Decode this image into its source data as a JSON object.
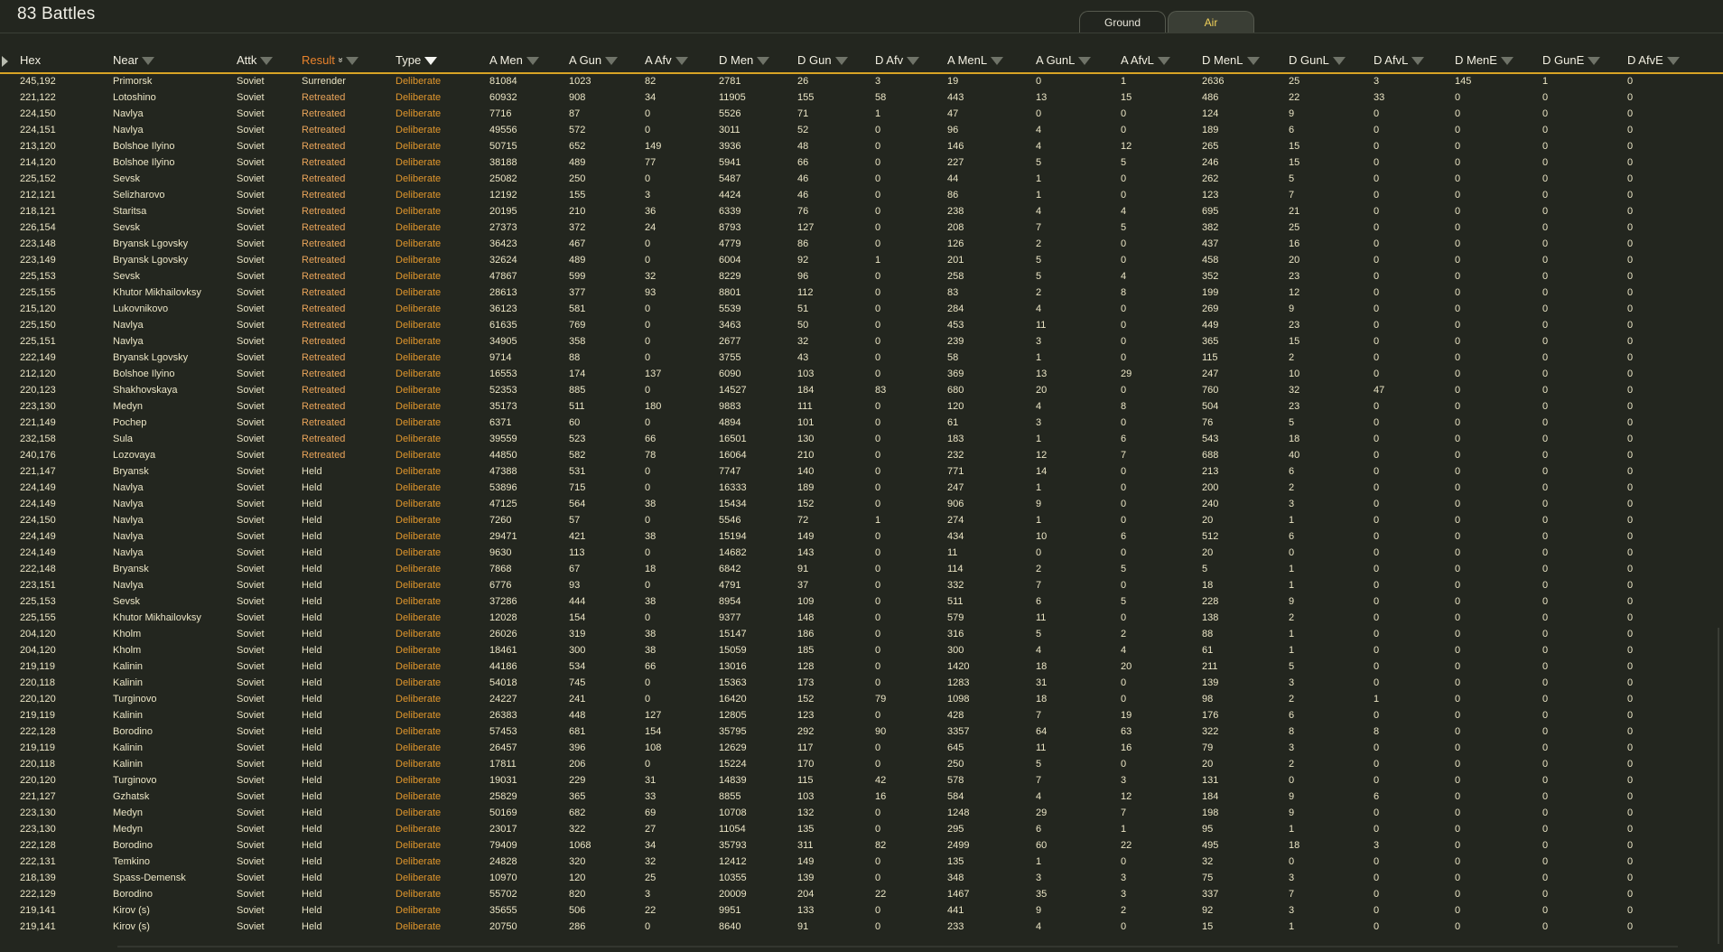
{
  "title": "83 Battles",
  "tabs": [
    {
      "label": "Ground",
      "active": false
    },
    {
      "label": "Air",
      "active": true
    }
  ],
  "colors": {
    "accent": "#d8a325",
    "type_text": "#e0962c",
    "sorted_header": "#e8822c",
    "background": "#23261f"
  },
  "columns": [
    {
      "key": "hex",
      "label": "Hex",
      "filter": false
    },
    {
      "key": "near",
      "label": "Near",
      "filter": true
    },
    {
      "key": "attk",
      "label": "Attk",
      "filter": true
    },
    {
      "key": "result",
      "label": "Result",
      "filter": true,
      "sorted": true
    },
    {
      "key": "type",
      "label": "Type",
      "filter": true,
      "filter_active": true
    },
    {
      "key": "a_men",
      "label": "A Men",
      "filter": true
    },
    {
      "key": "a_gun",
      "label": "A Gun",
      "filter": true
    },
    {
      "key": "a_afv",
      "label": "A Afv",
      "filter": true
    },
    {
      "key": "d_men",
      "label": "D Men",
      "filter": true
    },
    {
      "key": "d_gun",
      "label": "D Gun",
      "filter": true
    },
    {
      "key": "d_afv",
      "label": "D Afv",
      "filter": true
    },
    {
      "key": "a_menl",
      "label": "A MenL",
      "filter": true
    },
    {
      "key": "a_gunl",
      "label": "A GunL",
      "filter": true
    },
    {
      "key": "a_afvl",
      "label": "A AfvL",
      "filter": true
    },
    {
      "key": "d_menl",
      "label": "D MenL",
      "filter": true
    },
    {
      "key": "d_gunl",
      "label": "D GunL",
      "filter": true
    },
    {
      "key": "d_afvl",
      "label": "D AfvL",
      "filter": true
    },
    {
      "key": "d_mene",
      "label": "D MenE",
      "filter": true
    },
    {
      "key": "d_gune",
      "label": "D GunE",
      "filter": true
    },
    {
      "key": "d_afve",
      "label": "D AfvE",
      "filter": true
    }
  ],
  "rows": [
    [
      "245,192",
      "Primorsk",
      "Soviet",
      "Surrender",
      "Deliberate",
      "81084",
      "1023",
      "82",
      "2781",
      "26",
      "3",
      "19",
      "0",
      "1",
      "2636",
      "25",
      "3",
      "145",
      "1",
      "0"
    ],
    [
      "221,122",
      "Lotoshino",
      "Soviet",
      "Retreated",
      "Deliberate",
      "60932",
      "908",
      "34",
      "11905",
      "155",
      "58",
      "443",
      "13",
      "15",
      "486",
      "22",
      "33",
      "0",
      "0",
      "0"
    ],
    [
      "224,150",
      "Navlya",
      "Soviet",
      "Retreated",
      "Deliberate",
      "7716",
      "87",
      "0",
      "5526",
      "71",
      "1",
      "47",
      "0",
      "0",
      "124",
      "9",
      "0",
      "0",
      "0",
      "0"
    ],
    [
      "224,151",
      "Navlya",
      "Soviet",
      "Retreated",
      "Deliberate",
      "49556",
      "572",
      "0",
      "3011",
      "52",
      "0",
      "96",
      "4",
      "0",
      "189",
      "6",
      "0",
      "0",
      "0",
      "0"
    ],
    [
      "213,120",
      "Bolshoe Ilyino",
      "Soviet",
      "Retreated",
      "Deliberate",
      "50715",
      "652",
      "149",
      "3936",
      "48",
      "0",
      "146",
      "4",
      "12",
      "265",
      "15",
      "0",
      "0",
      "0",
      "0"
    ],
    [
      "214,120",
      "Bolshoe Ilyino",
      "Soviet",
      "Retreated",
      "Deliberate",
      "38188",
      "489",
      "77",
      "5941",
      "66",
      "0",
      "227",
      "5",
      "5",
      "246",
      "15",
      "0",
      "0",
      "0",
      "0"
    ],
    [
      "225,152",
      "Sevsk",
      "Soviet",
      "Retreated",
      "Deliberate",
      "25082",
      "250",
      "0",
      "5487",
      "46",
      "0",
      "44",
      "1",
      "0",
      "262",
      "5",
      "0",
      "0",
      "0",
      "0"
    ],
    [
      "212,121",
      "Selizharovo",
      "Soviet",
      "Retreated",
      "Deliberate",
      "12192",
      "155",
      "3",
      "4424",
      "46",
      "0",
      "86",
      "1",
      "0",
      "123",
      "7",
      "0",
      "0",
      "0",
      "0"
    ],
    [
      "218,121",
      "Staritsa",
      "Soviet",
      "Retreated",
      "Deliberate",
      "20195",
      "210",
      "36",
      "6339",
      "76",
      "0",
      "238",
      "4",
      "4",
      "695",
      "21",
      "0",
      "0",
      "0",
      "0"
    ],
    [
      "226,154",
      "Sevsk",
      "Soviet",
      "Retreated",
      "Deliberate",
      "27373",
      "372",
      "24",
      "8793",
      "127",
      "0",
      "208",
      "7",
      "5",
      "382",
      "25",
      "0",
      "0",
      "0",
      "0"
    ],
    [
      "223,148",
      "Bryansk Lgovsky",
      "Soviet",
      "Retreated",
      "Deliberate",
      "36423",
      "467",
      "0",
      "4779",
      "86",
      "0",
      "126",
      "2",
      "0",
      "437",
      "16",
      "0",
      "0",
      "0",
      "0"
    ],
    [
      "223,149",
      "Bryansk Lgovsky",
      "Soviet",
      "Retreated",
      "Deliberate",
      "32624",
      "489",
      "0",
      "6004",
      "92",
      "1",
      "201",
      "5",
      "0",
      "458",
      "20",
      "0",
      "0",
      "0",
      "0"
    ],
    [
      "225,153",
      "Sevsk",
      "Soviet",
      "Retreated",
      "Deliberate",
      "47867",
      "599",
      "32",
      "8229",
      "96",
      "0",
      "258",
      "5",
      "4",
      "352",
      "23",
      "0",
      "0",
      "0",
      "0"
    ],
    [
      "225,155",
      "Khutor Mikhailovksy",
      "Soviet",
      "Retreated",
      "Deliberate",
      "28613",
      "377",
      "93",
      "8801",
      "112",
      "0",
      "83",
      "2",
      "8",
      "199",
      "12",
      "0",
      "0",
      "0",
      "0"
    ],
    [
      "215,120",
      "Lukovnikovo",
      "Soviet",
      "Retreated",
      "Deliberate",
      "36123",
      "581",
      "0",
      "5539",
      "51",
      "0",
      "284",
      "4",
      "0",
      "269",
      "9",
      "0",
      "0",
      "0",
      "0"
    ],
    [
      "225,150",
      "Navlya",
      "Soviet",
      "Retreated",
      "Deliberate",
      "61635",
      "769",
      "0",
      "3463",
      "50",
      "0",
      "453",
      "11",
      "0",
      "449",
      "23",
      "0",
      "0",
      "0",
      "0"
    ],
    [
      "225,151",
      "Navlya",
      "Soviet",
      "Retreated",
      "Deliberate",
      "34905",
      "358",
      "0",
      "2677",
      "32",
      "0",
      "239",
      "3",
      "0",
      "365",
      "15",
      "0",
      "0",
      "0",
      "0"
    ],
    [
      "222,149",
      "Bryansk Lgovsky",
      "Soviet",
      "Retreated",
      "Deliberate",
      "9714",
      "88",
      "0",
      "3755",
      "43",
      "0",
      "58",
      "1",
      "0",
      "115",
      "2",
      "0",
      "0",
      "0",
      "0"
    ],
    [
      "212,120",
      "Bolshoe Ilyino",
      "Soviet",
      "Retreated",
      "Deliberate",
      "16553",
      "174",
      "137",
      "6090",
      "103",
      "0",
      "369",
      "13",
      "29",
      "247",
      "10",
      "0",
      "0",
      "0",
      "0"
    ],
    [
      "220,123",
      "Shakhovskaya",
      "Soviet",
      "Retreated",
      "Deliberate",
      "52353",
      "885",
      "0",
      "14527",
      "184",
      "83",
      "680",
      "20",
      "0",
      "760",
      "32",
      "47",
      "0",
      "0",
      "0"
    ],
    [
      "223,130",
      "Medyn",
      "Soviet",
      "Retreated",
      "Deliberate",
      "35173",
      "511",
      "180",
      "9883",
      "111",
      "0",
      "120",
      "4",
      "8",
      "504",
      "23",
      "0",
      "0",
      "0",
      "0"
    ],
    [
      "221,149",
      "Pochep",
      "Soviet",
      "Retreated",
      "Deliberate",
      "6371",
      "60",
      "0",
      "4894",
      "101",
      "0",
      "61",
      "3",
      "0",
      "76",
      "5",
      "0",
      "0",
      "0",
      "0"
    ],
    [
      "232,158",
      "Sula",
      "Soviet",
      "Retreated",
      "Deliberate",
      "39559",
      "523",
      "66",
      "16501",
      "130",
      "0",
      "183",
      "1",
      "6",
      "543",
      "18",
      "0",
      "0",
      "0",
      "0"
    ],
    [
      "240,176",
      "Lozovaya",
      "Soviet",
      "Retreated",
      "Deliberate",
      "44850",
      "582",
      "78",
      "16064",
      "210",
      "0",
      "232",
      "12",
      "7",
      "688",
      "40",
      "0",
      "0",
      "0",
      "0"
    ],
    [
      "221,147",
      "Bryansk",
      "Soviet",
      "Held",
      "Deliberate",
      "47388",
      "531",
      "0",
      "7747",
      "140",
      "0",
      "771",
      "14",
      "0",
      "213",
      "6",
      "0",
      "0",
      "0",
      "0"
    ],
    [
      "224,149",
      "Navlya",
      "Soviet",
      "Held",
      "Deliberate",
      "53896",
      "715",
      "0",
      "16333",
      "189",
      "0",
      "247",
      "1",
      "0",
      "200",
      "2",
      "0",
      "0",
      "0",
      "0"
    ],
    [
      "224,149",
      "Navlya",
      "Soviet",
      "Held",
      "Deliberate",
      "47125",
      "564",
      "38",
      "15434",
      "152",
      "0",
      "906",
      "9",
      "0",
      "240",
      "3",
      "0",
      "0",
      "0",
      "0"
    ],
    [
      "224,150",
      "Navlya",
      "Soviet",
      "Held",
      "Deliberate",
      "7260",
      "57",
      "0",
      "5546",
      "72",
      "1",
      "274",
      "1",
      "0",
      "20",
      "1",
      "0",
      "0",
      "0",
      "0"
    ],
    [
      "224,149",
      "Navlya",
      "Soviet",
      "Held",
      "Deliberate",
      "29471",
      "421",
      "38",
      "15194",
      "149",
      "0",
      "434",
      "10",
      "6",
      "512",
      "6",
      "0",
      "0",
      "0",
      "0"
    ],
    [
      "224,149",
      "Navlya",
      "Soviet",
      "Held",
      "Deliberate",
      "9630",
      "113",
      "0",
      "14682",
      "143",
      "0",
      "11",
      "0",
      "0",
      "20",
      "0",
      "0",
      "0",
      "0",
      "0"
    ],
    [
      "222,148",
      "Bryansk",
      "Soviet",
      "Held",
      "Deliberate",
      "7868",
      "67",
      "18",
      "6842",
      "91",
      "0",
      "114",
      "2",
      "5",
      "5",
      "1",
      "0",
      "0",
      "0",
      "0"
    ],
    [
      "223,151",
      "Navlya",
      "Soviet",
      "Held",
      "Deliberate",
      "6776",
      "93",
      "0",
      "4791",
      "37",
      "0",
      "332",
      "7",
      "0",
      "18",
      "1",
      "0",
      "0",
      "0",
      "0"
    ],
    [
      "225,153",
      "Sevsk",
      "Soviet",
      "Held",
      "Deliberate",
      "37286",
      "444",
      "38",
      "8954",
      "109",
      "0",
      "511",
      "6",
      "5",
      "228",
      "9",
      "0",
      "0",
      "0",
      "0"
    ],
    [
      "225,155",
      "Khutor Mikhailovksy",
      "Soviet",
      "Held",
      "Deliberate",
      "12028",
      "154",
      "0",
      "9377",
      "148",
      "0",
      "579",
      "11",
      "0",
      "138",
      "2",
      "0",
      "0",
      "0",
      "0"
    ],
    [
      "204,120",
      "Kholm",
      "Soviet",
      "Held",
      "Deliberate",
      "26026",
      "319",
      "38",
      "15147",
      "186",
      "0",
      "316",
      "5",
      "2",
      "88",
      "1",
      "0",
      "0",
      "0",
      "0"
    ],
    [
      "204,120",
      "Kholm",
      "Soviet",
      "Held",
      "Deliberate",
      "18461",
      "300",
      "38",
      "15059",
      "185",
      "0",
      "300",
      "4",
      "4",
      "61",
      "1",
      "0",
      "0",
      "0",
      "0"
    ],
    [
      "219,119",
      "Kalinin",
      "Soviet",
      "Held",
      "Deliberate",
      "44186",
      "534",
      "66",
      "13016",
      "128",
      "0",
      "1420",
      "18",
      "20",
      "211",
      "5",
      "0",
      "0",
      "0",
      "0"
    ],
    [
      "220,118",
      "Kalinin",
      "Soviet",
      "Held",
      "Deliberate",
      "54018",
      "745",
      "0",
      "15363",
      "173",
      "0",
      "1283",
      "31",
      "0",
      "139",
      "3",
      "0",
      "0",
      "0",
      "0"
    ],
    [
      "220,120",
      "Turginovo",
      "Soviet",
      "Held",
      "Deliberate",
      "24227",
      "241",
      "0",
      "16420",
      "152",
      "79",
      "1098",
      "18",
      "0",
      "98",
      "2",
      "1",
      "0",
      "0",
      "0"
    ],
    [
      "219,119",
      "Kalinin",
      "Soviet",
      "Held",
      "Deliberate",
      "26383",
      "448",
      "127",
      "12805",
      "123",
      "0",
      "428",
      "7",
      "19",
      "176",
      "6",
      "0",
      "0",
      "0",
      "0"
    ],
    [
      "222,128",
      "Borodino",
      "Soviet",
      "Held",
      "Deliberate",
      "57453",
      "681",
      "154",
      "35795",
      "292",
      "90",
      "3357",
      "64",
      "63",
      "322",
      "8",
      "8",
      "0",
      "0",
      "0"
    ],
    [
      "219,119",
      "Kalinin",
      "Soviet",
      "Held",
      "Deliberate",
      "26457",
      "396",
      "108",
      "12629",
      "117",
      "0",
      "645",
      "11",
      "16",
      "79",
      "3",
      "0",
      "0",
      "0",
      "0"
    ],
    [
      "220,118",
      "Kalinin",
      "Soviet",
      "Held",
      "Deliberate",
      "17811",
      "206",
      "0",
      "15224",
      "170",
      "0",
      "250",
      "5",
      "0",
      "20",
      "2",
      "0",
      "0",
      "0",
      "0"
    ],
    [
      "220,120",
      "Turginovo",
      "Soviet",
      "Held",
      "Deliberate",
      "19031",
      "229",
      "31",
      "14839",
      "115",
      "42",
      "578",
      "7",
      "3",
      "131",
      "0",
      "0",
      "0",
      "0",
      "0"
    ],
    [
      "221,127",
      "Gzhatsk",
      "Soviet",
      "Held",
      "Deliberate",
      "25829",
      "365",
      "33",
      "8855",
      "103",
      "16",
      "584",
      "4",
      "12",
      "184",
      "9",
      "6",
      "0",
      "0",
      "0"
    ],
    [
      "223,130",
      "Medyn",
      "Soviet",
      "Held",
      "Deliberate",
      "50169",
      "682",
      "69",
      "10708",
      "132",
      "0",
      "1248",
      "29",
      "7",
      "198",
      "9",
      "0",
      "0",
      "0",
      "0"
    ],
    [
      "223,130",
      "Medyn",
      "Soviet",
      "Held",
      "Deliberate",
      "23017",
      "322",
      "27",
      "11054",
      "135",
      "0",
      "295",
      "6",
      "1",
      "95",
      "1",
      "0",
      "0",
      "0",
      "0"
    ],
    [
      "222,128",
      "Borodino",
      "Soviet",
      "Held",
      "Deliberate",
      "79409",
      "1068",
      "34",
      "35793",
      "311",
      "82",
      "2499",
      "60",
      "22",
      "495",
      "18",
      "3",
      "0",
      "0",
      "0"
    ],
    [
      "222,131",
      "Temkino",
      "Soviet",
      "Held",
      "Deliberate",
      "24828",
      "320",
      "32",
      "12412",
      "149",
      "0",
      "135",
      "1",
      "0",
      "32",
      "0",
      "0",
      "0",
      "0",
      "0"
    ],
    [
      "218,139",
      "Spass-Demensk",
      "Soviet",
      "Held",
      "Deliberate",
      "10970",
      "120",
      "25",
      "10355",
      "139",
      "0",
      "348",
      "3",
      "3",
      "75",
      "3",
      "0",
      "0",
      "0",
      "0"
    ],
    [
      "222,129",
      "Borodino",
      "Soviet",
      "Held",
      "Deliberate",
      "55702",
      "820",
      "3",
      "20009",
      "204",
      "22",
      "1467",
      "35",
      "3",
      "337",
      "7",
      "0",
      "0",
      "0",
      "0"
    ],
    [
      "219,141",
      "Kirov (s)",
      "Soviet",
      "Held",
      "Deliberate",
      "35655",
      "506",
      "22",
      "9951",
      "133",
      "0",
      "441",
      "9",
      "2",
      "92",
      "3",
      "0",
      "0",
      "0",
      "0"
    ],
    [
      "219,141",
      "Kirov (s)",
      "Soviet",
      "Held",
      "Deliberate",
      "20750",
      "286",
      "0",
      "8640",
      "91",
      "0",
      "233",
      "4",
      "0",
      "15",
      "1",
      "0",
      "0",
      "0",
      "0"
    ]
  ]
}
